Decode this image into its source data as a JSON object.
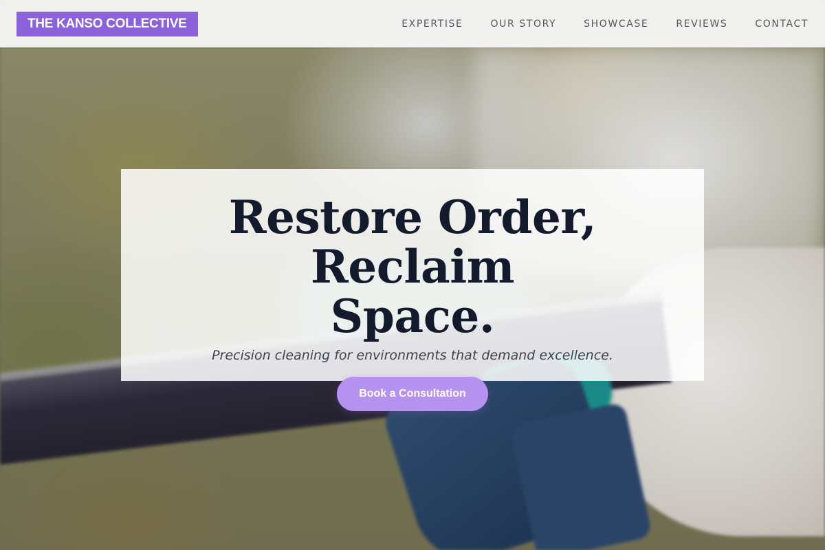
{
  "header": {
    "logo": "THE KANSO COLLECTIVE",
    "nav": [
      {
        "label": "EXPERTISE"
      },
      {
        "label": "OUR STORY"
      },
      {
        "label": "SHOWCASE"
      },
      {
        "label": "REVIEWS"
      },
      {
        "label": "CONTACT"
      }
    ]
  },
  "hero": {
    "title_line1": "Restore Order, Reclaim",
    "title_line2": "Space.",
    "subtitle": "Precision cleaning for environments that demand excellence.",
    "cta_label": "Book a Consultation"
  },
  "colors": {
    "brand_purple": "#8b62d9",
    "cta_purple": "#b692f0",
    "title_navy": "#131a2b"
  }
}
